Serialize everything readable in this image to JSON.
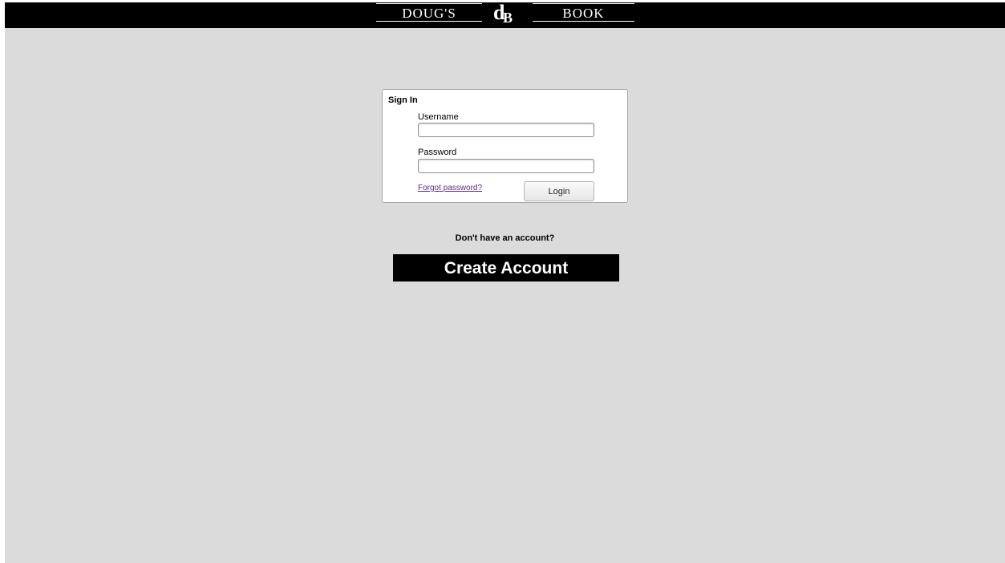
{
  "header": {
    "logo_left_word": "DOUG'S",
    "logo_right_word": "BOOK",
    "logo_mark_d": "d",
    "logo_mark_b": "B"
  },
  "signin": {
    "title": "Sign In",
    "username_label": "Username",
    "username_value": "",
    "password_label": "Password",
    "password_value": "",
    "forgot_link": "Forgot password?",
    "login_button": "Login"
  },
  "signup": {
    "prompt": "Don't have an account?",
    "create_button": "Create Account"
  },
  "colors": {
    "background": "#dbdbdb",
    "header_bar": "#000000",
    "link": "#5b2a86"
  }
}
